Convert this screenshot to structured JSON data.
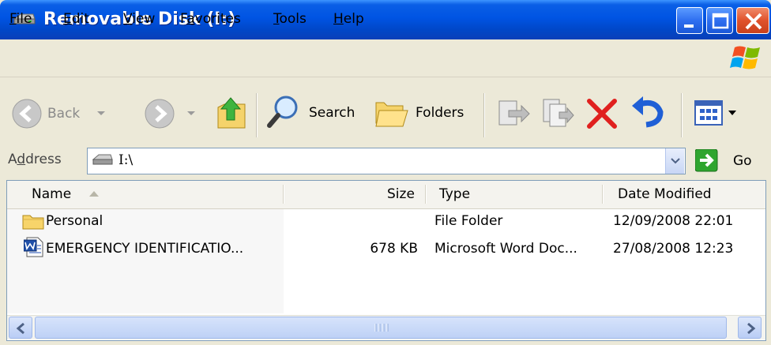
{
  "window": {
    "title": "Removable Disk (I:)",
    "icon": "drive-icon"
  },
  "menu": {
    "items": [
      {
        "pre": "",
        "ul": "F",
        "post": "ile"
      },
      {
        "pre": "",
        "ul": "E",
        "post": "dit"
      },
      {
        "pre": "",
        "ul": "V",
        "post": "iew"
      },
      {
        "pre": "F",
        "ul": "a",
        "post": "vorites"
      },
      {
        "pre": "",
        "ul": "T",
        "post": "ools"
      },
      {
        "pre": "",
        "ul": "H",
        "post": "elp"
      }
    ]
  },
  "toolbar": {
    "back_label": "Back",
    "search_label": "Search",
    "folders_label": "Folders"
  },
  "address": {
    "label_pre": "A",
    "label_ul": "d",
    "label_post": "dress",
    "value": "I:\\",
    "go_label": "Go"
  },
  "columns": {
    "name": "Name",
    "size": "Size",
    "type": "Type",
    "date": "Date Modified"
  },
  "files": [
    {
      "name": "Personal",
      "size": "",
      "type": "File Folder",
      "date": "12/09/2008 22:01",
      "icon": "folder-icon"
    },
    {
      "name": "EMERGENCY IDENTIFICATIO...",
      "size": "678 KB",
      "type": "Microsoft Word Doc...",
      "date": "27/08/2008 12:23",
      "icon": "word-document-icon"
    }
  ],
  "colors": {
    "titlebar": "#0054e3",
    "close_button": "#e0522c",
    "window_bg": "#ece9d8"
  }
}
